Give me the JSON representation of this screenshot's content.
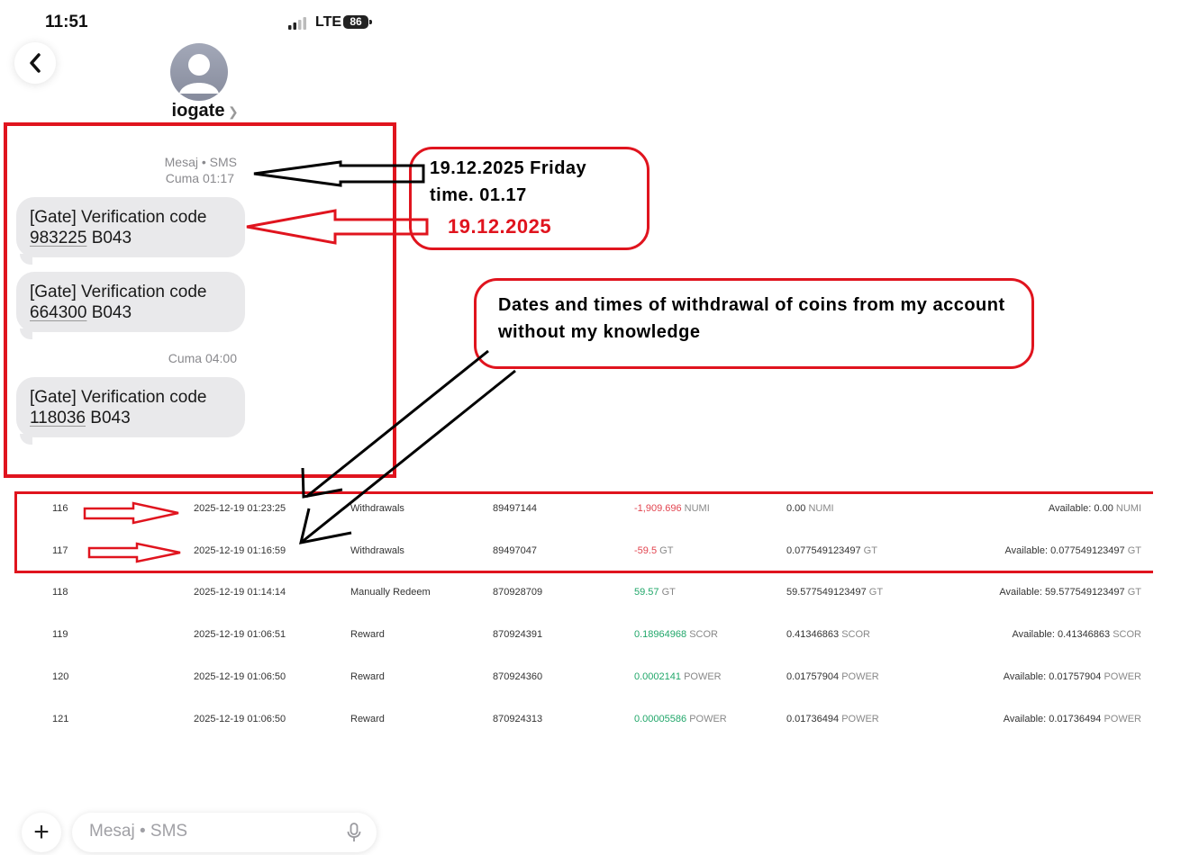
{
  "status_bar": {
    "time": "11:51",
    "network": "LTE",
    "battery": "86"
  },
  "header": {
    "contact_name": "iogate"
  },
  "conversation": {
    "meta1_line1": "Mesaj • SMS",
    "meta1_line2": "Cuma 01:17",
    "messages": [
      {
        "line1": "[Gate] Verification code",
        "code": "983225",
        "suffix": "B043"
      },
      {
        "line1": "[Gate] Verification code",
        "code": "664300",
        "suffix": "B043"
      },
      {
        "line1": "[Gate] Verification code",
        "code": "118036",
        "suffix": "B043"
      }
    ],
    "meta2": "Cuma 04:00"
  },
  "annotations": {
    "note1_line1": "19.12.2025 Friday",
    "note1_line2": "time. 01.17",
    "note1_date_red": "19.12.2025",
    "note2": "Dates and times of withdrawal of coins from my account without my knowledge",
    "colors": {
      "annotation_red": "#e0141e",
      "annotation_black": "#000000"
    }
  },
  "table": {
    "rows": [
      {
        "no": "116",
        "datetime": "2025-12-19 01:23:25",
        "type": "Withdrawals",
        "id": "89497144",
        "change": "-1,909.696",
        "change_unit": "NUMI",
        "change_sign": "neg",
        "balance": "0.00",
        "balance_unit": "NUMI",
        "available": "Available: 0.00",
        "available_unit": "NUMI"
      },
      {
        "no": "117",
        "datetime": "2025-12-19 01:16:59",
        "type": "Withdrawals",
        "id": "89497047",
        "change": "-59.5",
        "change_unit": "GT",
        "change_sign": "neg",
        "balance": "0.077549123497",
        "balance_unit": "GT",
        "available": "Available: 0.077549123497",
        "available_unit": "GT"
      },
      {
        "no": "118",
        "datetime": "2025-12-19 01:14:14",
        "type": "Manually Redeem",
        "id": "870928709",
        "change": "59.57",
        "change_unit": "GT",
        "change_sign": "pos",
        "balance": "59.577549123497",
        "balance_unit": "GT",
        "available": "Available: 59.577549123497",
        "available_unit": "GT"
      },
      {
        "no": "119",
        "datetime": "2025-12-19 01:06:51",
        "type": "Reward",
        "id": "870924391",
        "change": "0.18964968",
        "change_unit": "SCOR",
        "change_sign": "pos",
        "balance": "0.41346863",
        "balance_unit": "SCOR",
        "available": "Available: 0.41346863",
        "available_unit": "SCOR"
      },
      {
        "no": "120",
        "datetime": "2025-12-19 01:06:50",
        "type": "Reward",
        "id": "870924360",
        "change": "0.0002141",
        "change_unit": "POWER",
        "change_sign": "pos",
        "balance": "0.01757904",
        "balance_unit": "POWER",
        "available": "Available: 0.01757904",
        "available_unit": "POWER"
      },
      {
        "no": "121",
        "datetime": "2025-12-19 01:06:50",
        "type": "Reward",
        "id": "870924313",
        "change": "0.00005586",
        "change_unit": "POWER",
        "change_sign": "pos",
        "balance": "0.01736494",
        "balance_unit": "POWER",
        "available": "Available: 0.01736494",
        "available_unit": "POWER"
      }
    ]
  },
  "composer": {
    "placeholder": "Mesaj • SMS"
  },
  "icons": {
    "back": "chevron-left-icon",
    "avatar": "person-icon",
    "add": "plus-icon",
    "mic": "microphone-icon",
    "signal": "signal-bars-icon",
    "battery": "battery-icon"
  }
}
